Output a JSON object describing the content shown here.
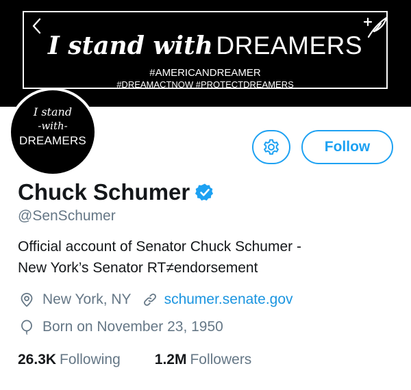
{
  "banner": {
    "headline_script": "I stand with",
    "headline_caps": "DREAMERS",
    "tag_line_1": "#AMERICANDREAMER",
    "tag_line_2": "#DREAMACTNOW #PROTECTDREAMERS"
  },
  "avatar": {
    "line_1": "I stand",
    "line_2": "-with-",
    "line_3": "DREAMERS"
  },
  "actions": {
    "follow_label": "Follow"
  },
  "profile": {
    "name": "Chuck Schumer",
    "handle": "@SenSchumer",
    "verified": true,
    "bio_line_1": "Official account of Senator Chuck Schumer -",
    "bio_line_2": "New York’s Senator RT≠endorsement",
    "location": "New York, NY",
    "website": "schumer.senate.gov",
    "birthday": "Born on November 23, 1950"
  },
  "stats": {
    "following_count": "26.3K",
    "following_label": "Following",
    "followers_count": "1.2M",
    "followers_label": "Followers"
  },
  "colors": {
    "accent": "#1da1f2",
    "link": "#1b95e0",
    "secondary_text": "#657786",
    "primary_text": "#14171a",
    "banner_bg": "#000000"
  },
  "icons": {
    "back": "chevron-left-icon",
    "compose": "quill-plus-icon",
    "settings": "gear-icon",
    "verified": "verified-badge-icon",
    "location": "location-pin-icon",
    "website": "link-icon",
    "birthday": "balloon-icon"
  }
}
